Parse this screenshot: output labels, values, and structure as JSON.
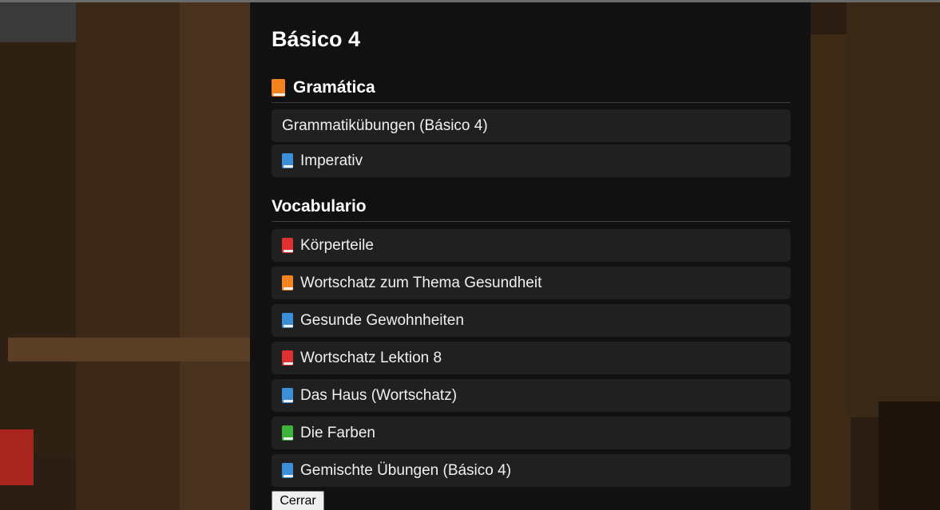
{
  "panel": {
    "title": "Básico 4",
    "sections": [
      {
        "title": "Gramática",
        "title_icon": {
          "name": "orange-book-icon",
          "color": "#f5841f"
        },
        "items": [
          {
            "label": "Grammatikübungen (Básico 4)",
            "icon": null
          },
          {
            "label": "Imperativ",
            "icon": {
              "name": "blue-book-icon",
              "color": "#3b8fd9"
            }
          }
        ]
      },
      {
        "title": "Vocabulario",
        "title_icon": null,
        "items": [
          {
            "label": "Körperteile",
            "icon": {
              "name": "red-book-icon",
              "color": "#e03030"
            }
          },
          {
            "label": "Wortschatz zum Thema Gesundheit",
            "icon": {
              "name": "orange-book-icon",
              "color": "#f5841f"
            }
          },
          {
            "label": "Gesunde Gewohnheiten",
            "icon": {
              "name": "blue-book-icon",
              "color": "#3b8fd9"
            }
          },
          {
            "label": "Wortschatz Lektion 8",
            "icon": {
              "name": "red-book-icon",
              "color": "#e03030"
            }
          },
          {
            "label": "Das Haus (Wortschatz)",
            "icon": {
              "name": "blue-book-icon",
              "color": "#3b8fd9"
            }
          },
          {
            "label": "Die Farben",
            "icon": {
              "name": "green-book-icon",
              "color": "#3cb43c"
            }
          },
          {
            "label": "Gemischte Übungen (Básico 4)",
            "icon": {
              "name": "blue-book-icon",
              "color": "#3b8fd9"
            }
          }
        ]
      }
    ],
    "close_label": "Cerrar"
  },
  "colors": {
    "panel_bg": "#111111",
    "item_bg": "#202020",
    "text": "#ffffff"
  }
}
